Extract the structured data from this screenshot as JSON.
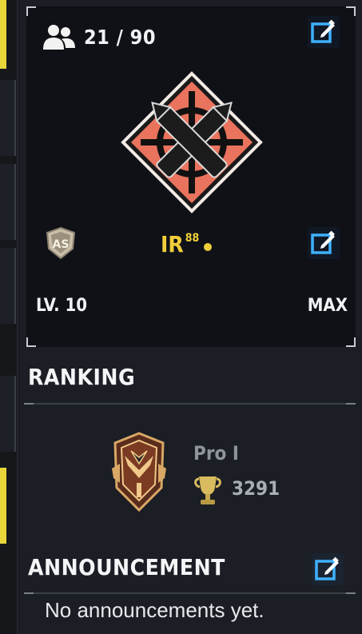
{
  "clan": {
    "member_count": "21 / 90",
    "tag": "IR",
    "tag_suffix": "88",
    "level": "LV. 10",
    "level_status": "MAX",
    "badge_text": "AS"
  },
  "ranking": {
    "title": "RANKING",
    "tier": "Pro I",
    "score": "3291"
  },
  "announcement": {
    "title": "ANNOUNCEMENT",
    "text": "No announcements yet."
  },
  "icons": {
    "members": "members-icon",
    "edit": "edit-icon",
    "trophy": "trophy-icon",
    "emblem": "crossed-bullets-crosshair-emblem"
  },
  "colors": {
    "accent_yellow": "#f0cf3a",
    "emblem_orange": "#e9735d",
    "edit_blue": "#2aa6ff",
    "panel_bg": "#0f1117",
    "page_bg": "#1b1e24"
  }
}
